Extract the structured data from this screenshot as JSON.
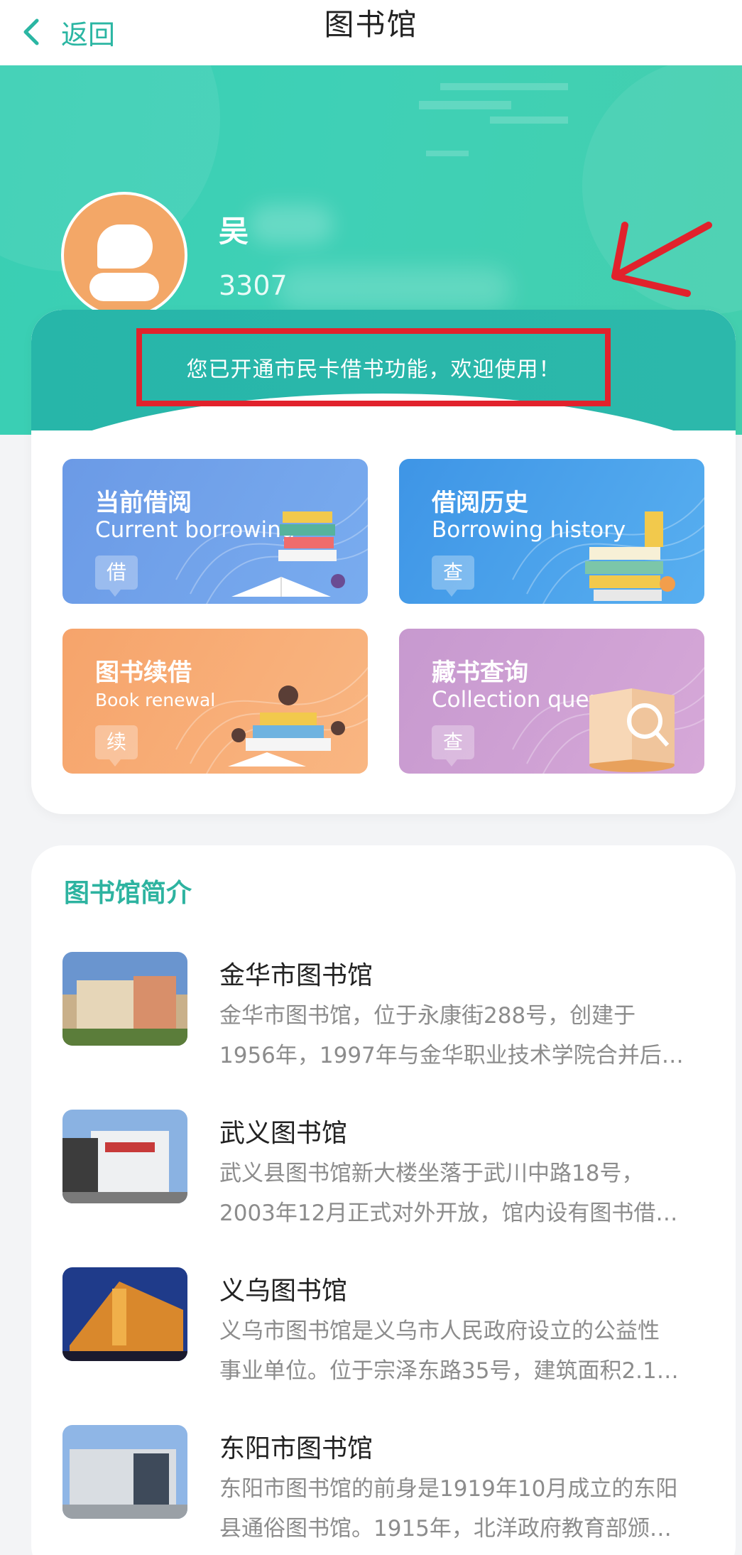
{
  "nav": {
    "back_label": "返回",
    "title": "图书馆"
  },
  "user": {
    "name": "吴",
    "id": "3307"
  },
  "notice": "您已开通市民卡借书功能，欢迎使用！",
  "functions": [
    {
      "title": "当前借阅",
      "subtitle": "Current borrowing",
      "badge": "借",
      "color": "#6b9ae6"
    },
    {
      "title": "借阅历史",
      "subtitle": "Borrowing history",
      "badge": "查",
      "color": "#3e95e6"
    },
    {
      "title": "图书续借",
      "subtitle": "Book renewal",
      "badge": "续",
      "color": "#f6a46b"
    },
    {
      "title": "藏书查询",
      "subtitle": "Collection query",
      "badge": "查",
      "color": "#c799cf"
    }
  ],
  "intro": {
    "title": "图书馆简介",
    "libraries": [
      {
        "name": "金华市图书馆",
        "desc1": "金华市图书馆，位于永康街288号，创建于",
        "desc2": "1956年，1997年与金华职业技术学院合并后…"
      },
      {
        "name": "武义图书馆",
        "desc1": "武义县图书馆新大楼坐落于武川中路18号，",
        "desc2": "2003年12月正式对外开放，馆内设有图书借…"
      },
      {
        "name": "义乌图书馆",
        "desc1": "义乌市图书馆是义乌市人民政府设立的公益性",
        "desc2": "事业单位。位于宗泽东路35号，建筑面积2.1…"
      },
      {
        "name": "东阳市图书馆",
        "desc1": "东阳市图书馆的前身是1919年10月成立的东阳",
        "desc2": "县通俗图书馆。1915年，北洋政府教育部颁…"
      }
    ]
  },
  "colors": {
    "accent": "#2bb6a3",
    "highlight": "#e1222c"
  }
}
